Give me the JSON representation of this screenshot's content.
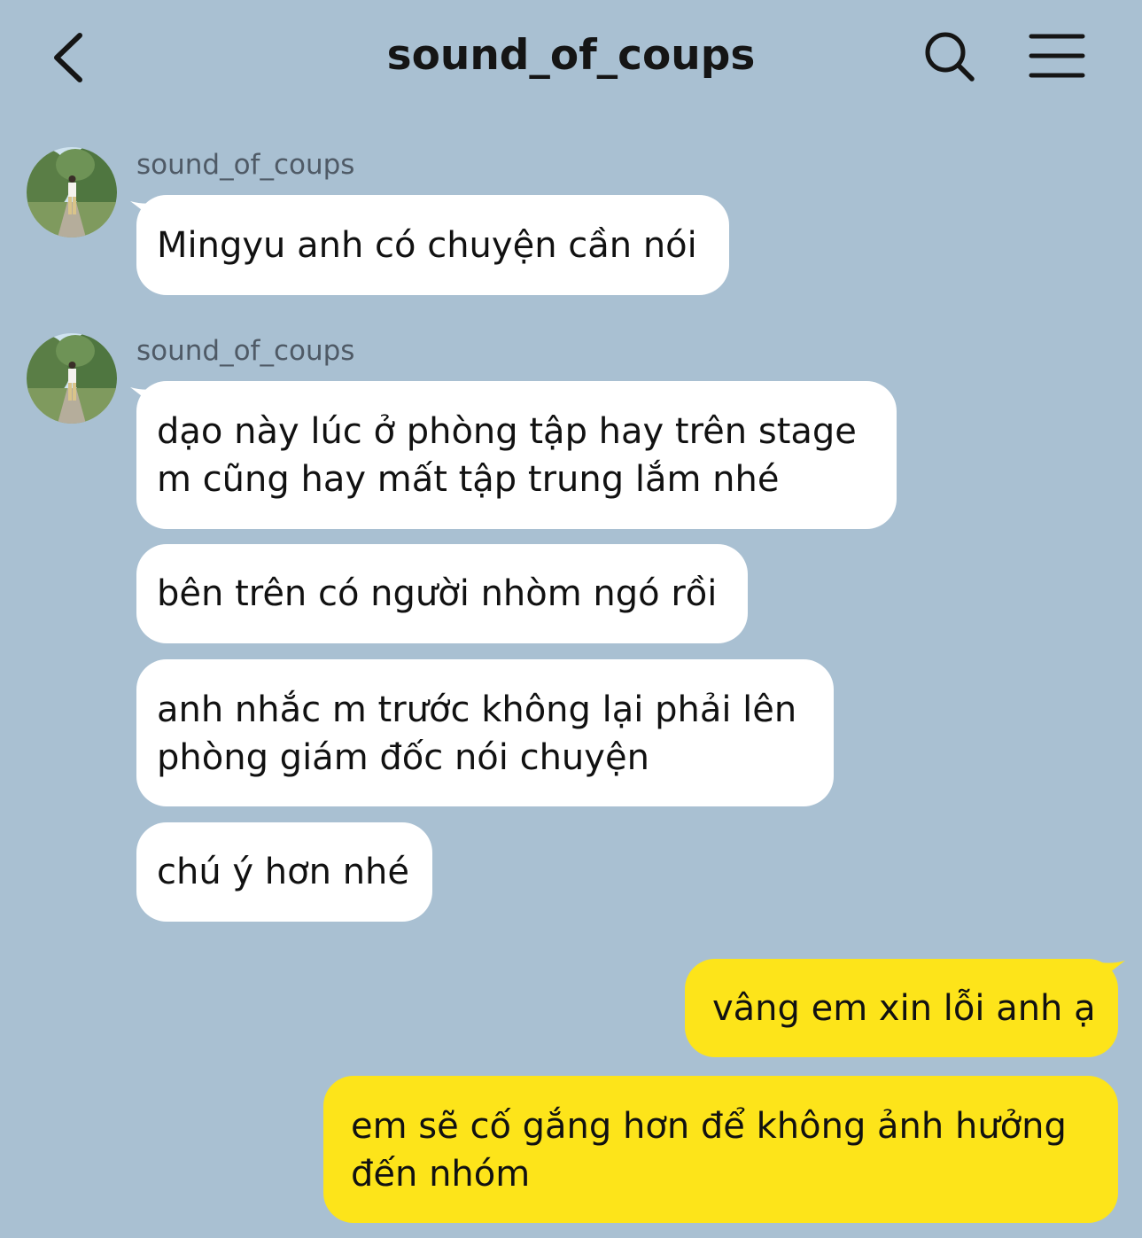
{
  "header": {
    "title": "sound_of_coups"
  },
  "colors": {
    "background": "#a9c0d2",
    "incoming_bubble": "#ffffff",
    "outgoing_bubble": "#fde41a"
  },
  "messages": {
    "group1": {
      "sender": "sound_of_coups",
      "items": [
        "Mingyu anh có chuyện cần nói"
      ]
    },
    "group2": {
      "sender": "sound_of_coups",
      "items": [
        [
          "dạo này lúc ở phòng tập hay trên stage",
          "m cũng hay mất tập trung lắm nhé"
        ],
        "bên trên có người nhòm ngó rồi",
        [
          "anh nhắc m trước không lại phải lên",
          "phòng giám đốc nói chuyện"
        ],
        "chú ý hơn nhé"
      ]
    },
    "outgoing": [
      "vâng em xin lỗi anh ạ",
      [
        "em sẽ cố gắng hơn để không ảnh hưởng",
        "đến nhóm"
      ]
    ]
  }
}
